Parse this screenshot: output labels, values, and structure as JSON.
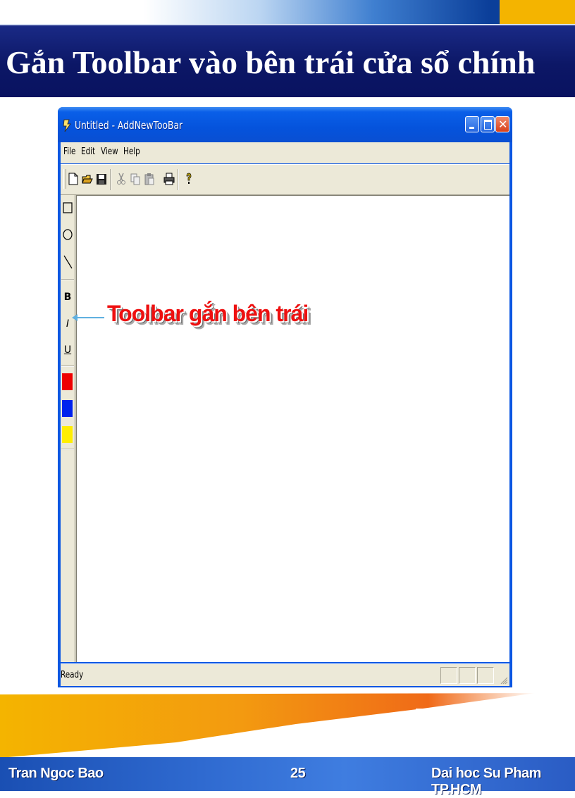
{
  "slide": {
    "title": "Gắn Toolbar vào bên trái cửa sổ chính",
    "annotation": "Toolbar gắn bên trái",
    "footer": {
      "author": "Tran Ngoc Bao",
      "page": "25",
      "school": "Dai hoc Su Pham TP.HCM"
    },
    "colors": {
      "title_band": "#0c1766",
      "footer": "#2f6ad0",
      "accent": "#f4b400",
      "annotation": "#ee1010"
    }
  },
  "window": {
    "title": "Untitled - AddNewTooBar",
    "menu": [
      "File",
      "Edit",
      "View",
      "Help"
    ],
    "toolbar_icons": [
      "new-icon",
      "open-icon",
      "save-icon",
      "cut-icon",
      "copy-icon",
      "paste-icon",
      "print-icon",
      "help-icon"
    ],
    "left_toolbar": {
      "shapes": [
        "rectangle-icon",
        "ellipse-icon",
        "line-icon"
      ],
      "text_styles": [
        "B",
        "I",
        "U"
      ],
      "colors": [
        "#ee0000",
        "#0022ee",
        "#ffee00"
      ]
    },
    "status": "Ready"
  }
}
